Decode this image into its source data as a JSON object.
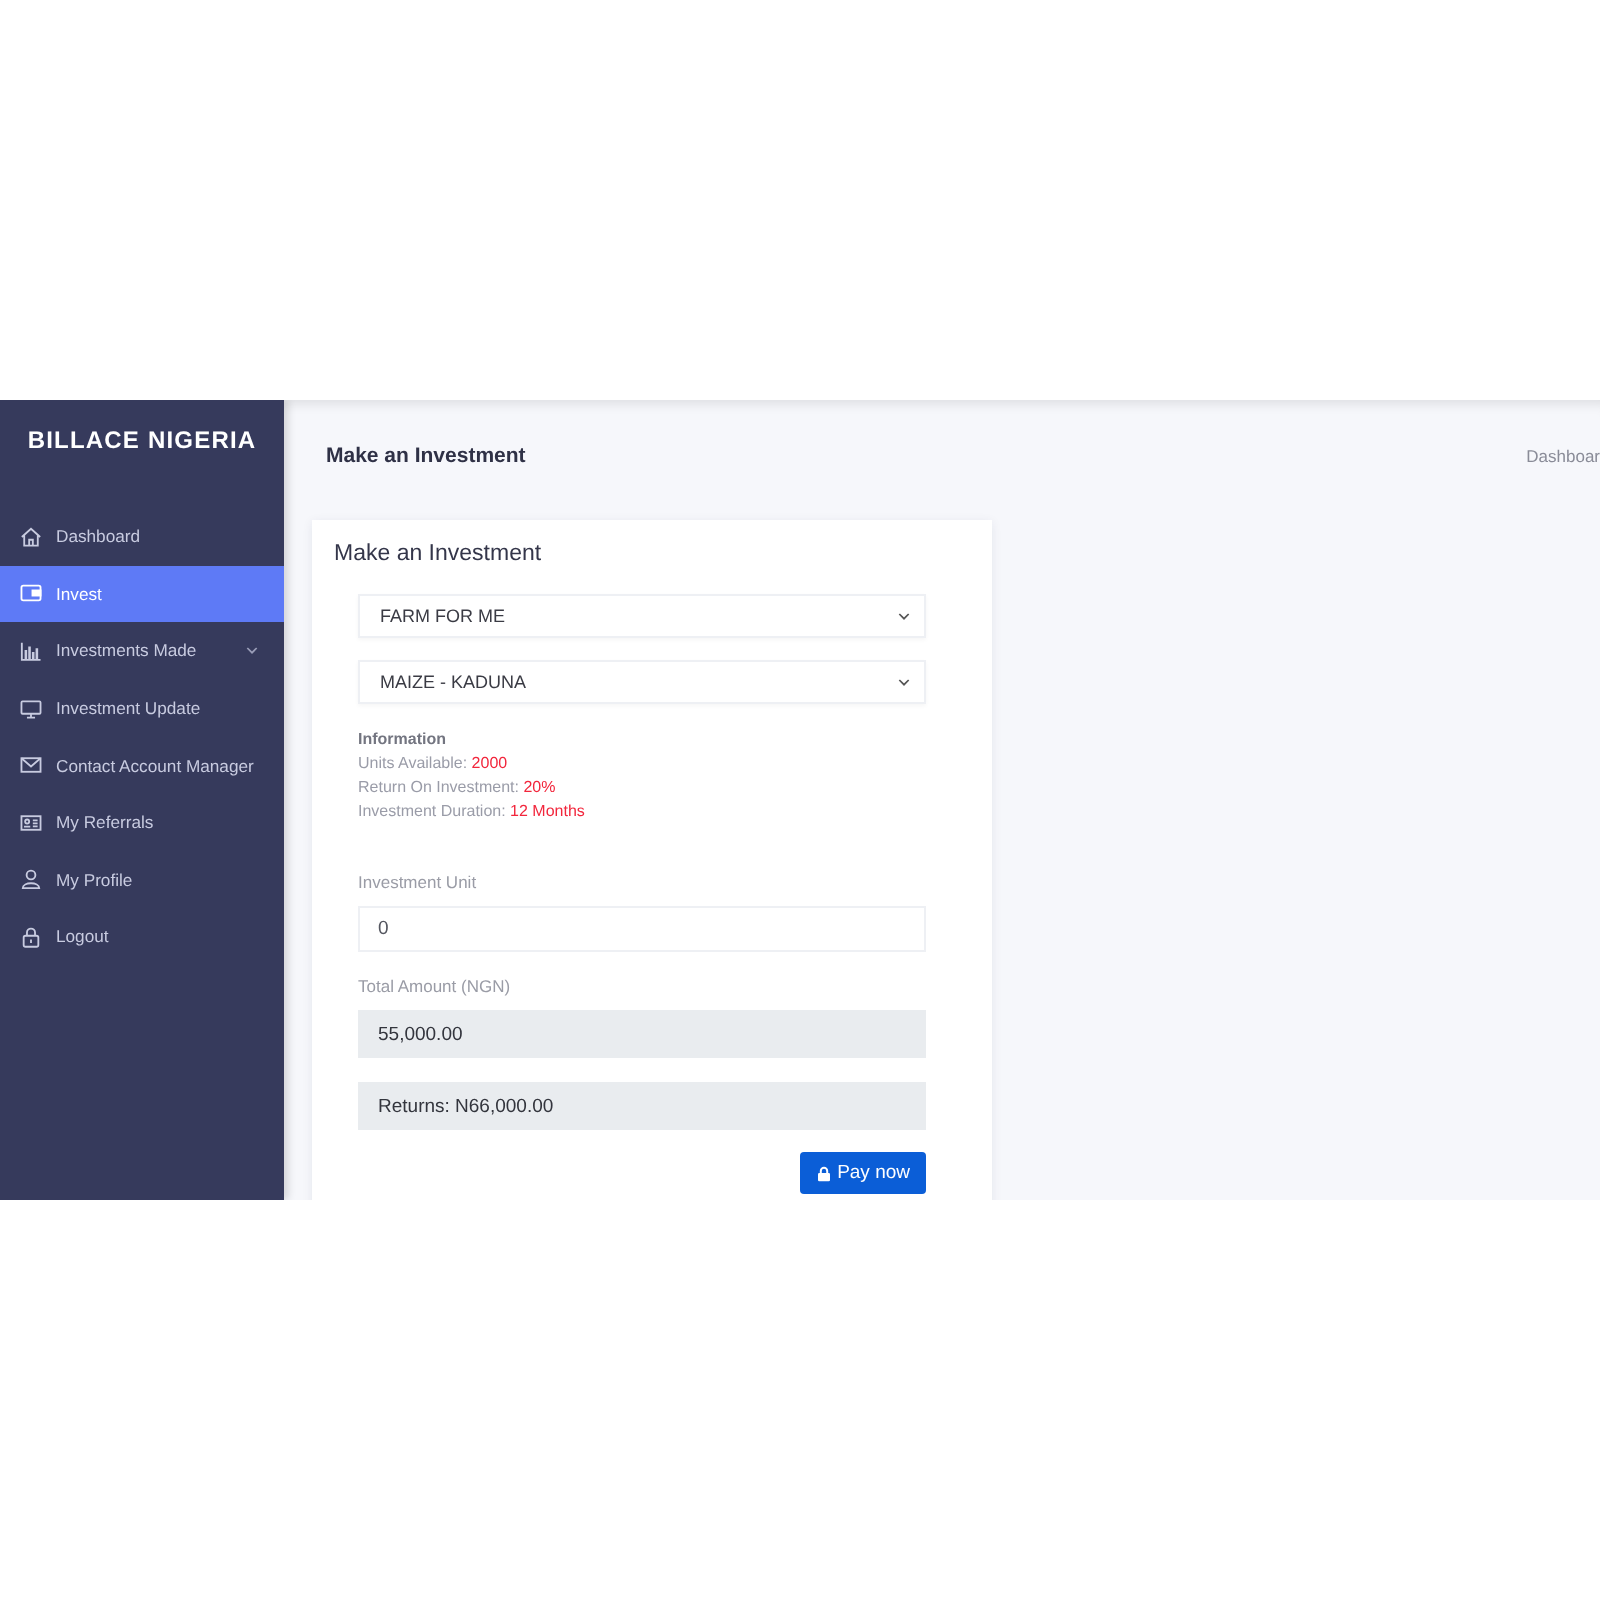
{
  "brand": "BILLACE NIGERIA",
  "sidebar": {
    "items": [
      {
        "label": "Dashboard",
        "selected": false,
        "submenu": false
      },
      {
        "label": "Invest",
        "selected": true,
        "submenu": false
      },
      {
        "label": "Investments Made",
        "selected": false,
        "submenu": true
      },
      {
        "label": "Investment Update",
        "selected": false,
        "submenu": false
      },
      {
        "label": "Contact Account Manager",
        "selected": false,
        "submenu": false
      },
      {
        "label": "My Referrals",
        "selected": false,
        "submenu": false
      },
      {
        "label": "My Profile",
        "selected": false,
        "submenu": false
      },
      {
        "label": "Logout",
        "selected": false,
        "submenu": false
      }
    ]
  },
  "header": {
    "title": "Make an Investment",
    "breadcrumb": "Dashboar"
  },
  "card": {
    "title": "Make an Investment",
    "selects": [
      {
        "value": "FARM FOR ME"
      },
      {
        "value": "MAIZE - KADUNA"
      }
    ],
    "information": {
      "heading": "Information",
      "rows": [
        {
          "label": "Units Available:",
          "value": "2000"
        },
        {
          "label": "Return On Investment:",
          "value": "20%"
        },
        {
          "label": "Investment Duration:",
          "value": "12 Months"
        }
      ]
    },
    "fields": [
      {
        "label": "Investment Unit",
        "value": "0",
        "readonly": false
      },
      {
        "label": "Total Amount (NGN)",
        "value": "55,000.00",
        "readonly": true
      },
      {
        "value": "Returns: N66,000.00",
        "readonly": true
      }
    ],
    "button": {
      "label": "Pay now"
    }
  }
}
